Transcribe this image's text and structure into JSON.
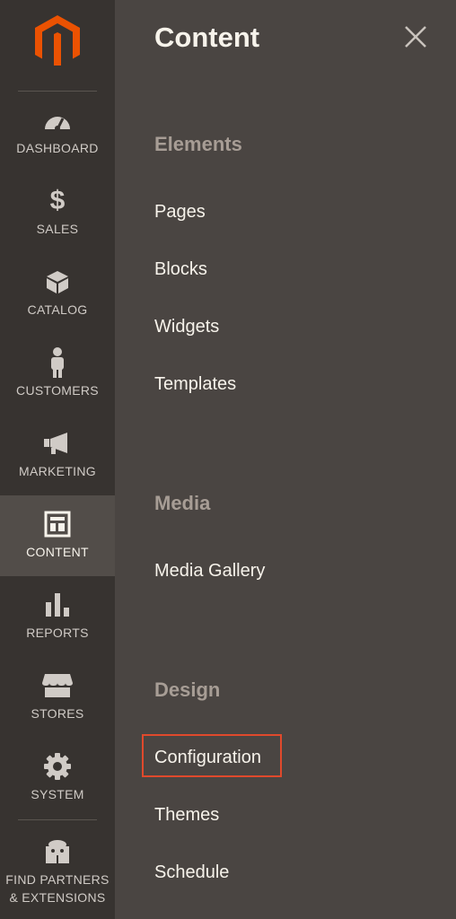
{
  "nav": {
    "items": [
      {
        "label": "DASHBOARD",
        "icon": "dashboard-icon"
      },
      {
        "label": "SALES",
        "icon": "dollar-icon"
      },
      {
        "label": "CATALOG",
        "icon": "box-icon"
      },
      {
        "label": "CUSTOMERS",
        "icon": "person-icon"
      },
      {
        "label": "MARKETING",
        "icon": "megaphone-icon"
      },
      {
        "label": "CONTENT",
        "icon": "layout-icon"
      },
      {
        "label": "REPORTS",
        "icon": "bar-chart-icon"
      },
      {
        "label": "STORES",
        "icon": "storefront-icon"
      },
      {
        "label": "SYSTEM",
        "icon": "gear-icon"
      },
      {
        "label": "FIND PARTNERS\n& EXTENSIONS",
        "icon": "blocks-icon"
      }
    ],
    "active": "CONTENT"
  },
  "panel": {
    "title": "Content",
    "sections": [
      {
        "title": "Elements",
        "links": [
          "Pages",
          "Blocks",
          "Widgets",
          "Templates"
        ]
      },
      {
        "title": "Media",
        "links": [
          "Media Gallery"
        ]
      },
      {
        "title": "Design",
        "links": [
          "Configuration",
          "Themes",
          "Schedule"
        ]
      }
    ],
    "highlighted_link": "Configuration"
  },
  "colors": {
    "nav_bg": "#373330",
    "nav_active_bg": "#524d49",
    "panel_bg": "#4a4542",
    "section_title": "#a79d95",
    "highlight_border": "#e0492c",
    "logo_orange": "#eb5202"
  }
}
